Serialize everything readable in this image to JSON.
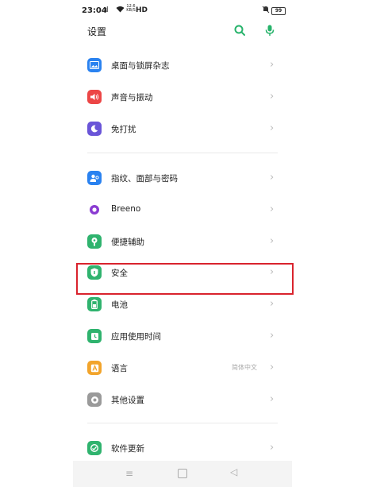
{
  "status_bar": {
    "time": "23:04",
    "signal": "ııl",
    "speed_value": "12.6",
    "speed_unit": "KB/S",
    "network": "HD",
    "battery": "99"
  },
  "header": {
    "title": "设置"
  },
  "colors": {
    "accent_green": "#27b36b",
    "highlight_red": "#d9232d"
  },
  "settings": [
    {
      "label": "桌面与锁屏杂志",
      "icon": "picture-icon",
      "color": "#2a82f0"
    },
    {
      "label": "声音与振动",
      "icon": "speaker-icon",
      "color": "#ec4646"
    },
    {
      "label": "免打扰",
      "icon": "moon-icon",
      "color": "#6a55d8"
    },
    {
      "label": "指纹、面部与密码",
      "icon": "person-key-icon",
      "color": "#2a82f0"
    },
    {
      "label": "Breeno",
      "icon": "breeno-icon",
      "color": "#8a3bd1"
    },
    {
      "label": "便捷辅助",
      "icon": "hand-icon",
      "color": "#2fb36e"
    },
    {
      "label": "安全",
      "icon": "shield-icon",
      "color": "#2fb36e"
    },
    {
      "label": "电池",
      "icon": "battery-icon",
      "color": "#2fb36e"
    },
    {
      "label": "应用使用时间",
      "icon": "timer-icon",
      "color": "#2fb36e"
    },
    {
      "label": "语言",
      "value": "简体中文",
      "icon": "language-icon",
      "color": "#f2a42b"
    },
    {
      "label": "其他设置",
      "icon": "more-settings-icon",
      "color": "#9a9a9a"
    },
    {
      "label": "软件更新",
      "icon": "update-icon",
      "color": "#2fb36e"
    }
  ],
  "nav": {
    "menu": "≡",
    "back": "◁"
  }
}
